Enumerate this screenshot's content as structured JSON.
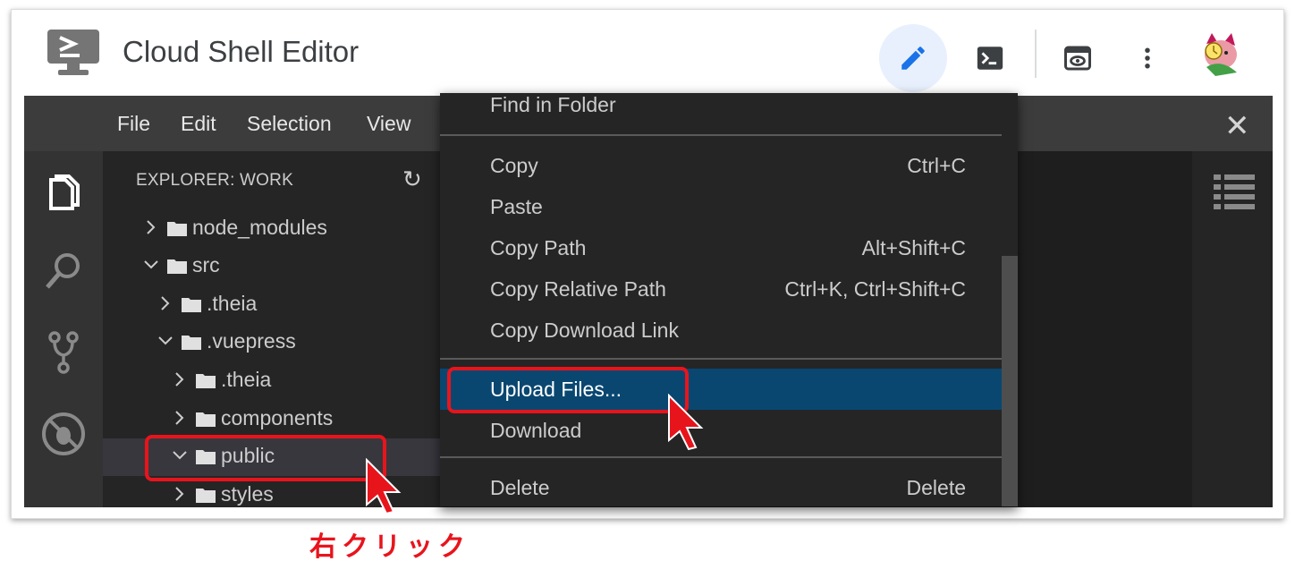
{
  "app": {
    "title": "Cloud Shell Editor",
    "toolbar_icons": [
      "pencil-icon",
      "terminal-icon",
      "preview-icon",
      "more-vert-icon",
      "avatar"
    ]
  },
  "menubar": {
    "items": [
      "File",
      "Edit",
      "Selection",
      "View"
    ],
    "close_icon": "close-icon"
  },
  "activity_icons": [
    "explorer-icon",
    "search-icon",
    "source-control-icon",
    "debug-icon"
  ],
  "explorer": {
    "title": "EXPLORER: WORK",
    "tree": [
      {
        "label": "node_modules",
        "expanded": false,
        "depth": 0
      },
      {
        "label": "src",
        "expanded": true,
        "depth": 0
      },
      {
        "label": ".theia",
        "expanded": false,
        "depth": 1
      },
      {
        "label": ".vuepress",
        "expanded": true,
        "depth": 1
      },
      {
        "label": ".theia",
        "expanded": false,
        "depth": 2
      },
      {
        "label": "components",
        "expanded": false,
        "depth": 2
      },
      {
        "label": "public",
        "expanded": true,
        "depth": 2,
        "selected": true
      },
      {
        "label": "styles",
        "expanded": false,
        "depth": 2
      }
    ]
  },
  "context_menu": {
    "items": [
      {
        "label": "Find in Folder",
        "shortcut": ""
      },
      {
        "label": "Copy",
        "shortcut": "Ctrl+C"
      },
      {
        "label": "Paste",
        "shortcut": ""
      },
      {
        "label": "Copy Path",
        "shortcut": "Alt+Shift+C"
      },
      {
        "label": "Copy Relative Path",
        "shortcut": "Ctrl+K, Ctrl+Shift+C"
      },
      {
        "label": "Copy Download Link",
        "shortcut": ""
      },
      {
        "label": "Upload Files...",
        "shortcut": "",
        "highlighted": true
      },
      {
        "label": "Download",
        "shortcut": ""
      },
      {
        "label": "Delete",
        "shortcut": "Delete"
      }
    ]
  },
  "annotation": {
    "caption": "右クリック",
    "color": "#e8141c"
  },
  "colors": {
    "menubar": "#3c3c3c",
    "sidebar": "#252526",
    "activitybar": "#333333",
    "highlight": "#094771",
    "accent_blue": "#1a73e8"
  }
}
